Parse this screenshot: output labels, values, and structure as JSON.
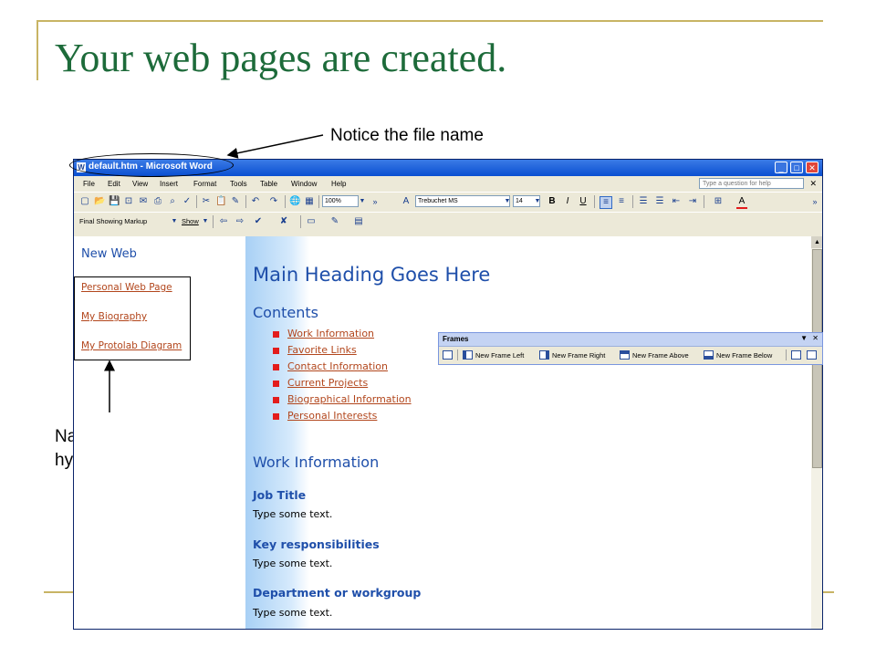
{
  "slide": {
    "title": "Your web pages are created.",
    "callout_file_name": "Notice the file name",
    "callout_nav_line1": "Navigational",
    "callout_nav_line2": "hyperlinks"
  },
  "window": {
    "title": "default.htm - Microsoft Word",
    "help_placeholder": "Type a question for help"
  },
  "menu": [
    "File",
    "Edit",
    "View",
    "Insert",
    "Format",
    "Tools",
    "Table",
    "Window",
    "Help"
  ],
  "toolbar": {
    "zoom": "100%",
    "font": "Trebuchet MS",
    "font_size": "14",
    "bold": "B",
    "italic": "I",
    "underline": "U",
    "markup_view": "Final Showing Markup",
    "show_label": "Show"
  },
  "left_frame": {
    "heading": "New Web",
    "links": [
      "Personal Web Page",
      "My Biography",
      "My Protolab Diagram"
    ]
  },
  "right_frame": {
    "main_heading": "Main Heading Goes Here",
    "contents_heading": "Contents",
    "contents": [
      "Work Information",
      "Favorite Links",
      "Contact Information",
      "Current Projects",
      "Biographical Information",
      "Personal Interests"
    ],
    "section_heading": "Work Information",
    "subsections": [
      {
        "title": "Job Title",
        "text": "Type some text."
      },
      {
        "title": "Key responsibilities",
        "text": "Type some text."
      },
      {
        "title": "Department or workgroup",
        "text": "Type some text."
      }
    ]
  },
  "frames_toolbar": {
    "title": "Frames",
    "buttons": [
      "New Frame Left",
      "New Frame Right",
      "New Frame Above",
      "New Frame Below"
    ]
  },
  "colors": {
    "title_green": "#1d6b3a",
    "accent_gold": "#c8b464",
    "link": "#b2461c",
    "heading_blue": "#1f4faa",
    "bullet_red": "#e31c1c"
  }
}
